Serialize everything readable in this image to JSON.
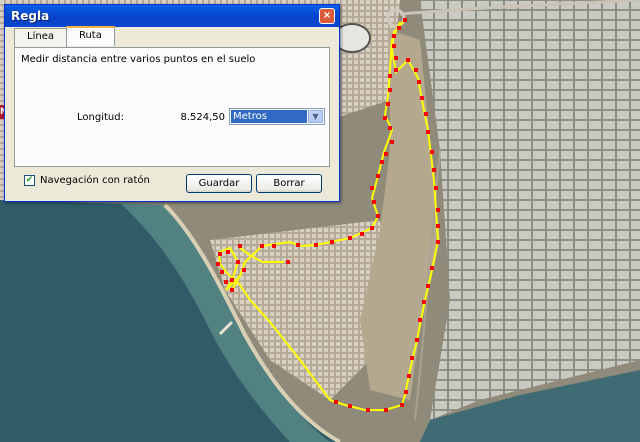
{
  "window": {
    "title": "Regla",
    "close_symbol": "×"
  },
  "tabs": [
    {
      "label": "Línea",
      "active": false
    },
    {
      "label": "Ruta",
      "active": true
    }
  ],
  "panel": {
    "description": "Medir distancia entre varios puntos en el suelo",
    "length_label": "Longitud:",
    "length_value": "8.524,50",
    "unit_selected": "Metros"
  },
  "mouse_navigation": {
    "label": "Navegación con ratón",
    "checked": true
  },
  "buttons": {
    "save": "Guardar",
    "clear": "Borrar"
  },
  "map": {
    "marker_label": "N-"
  },
  "colors": {
    "route_line": "#ffff00",
    "route_point": "#ff0000",
    "titlebar": "#0842c6"
  }
}
